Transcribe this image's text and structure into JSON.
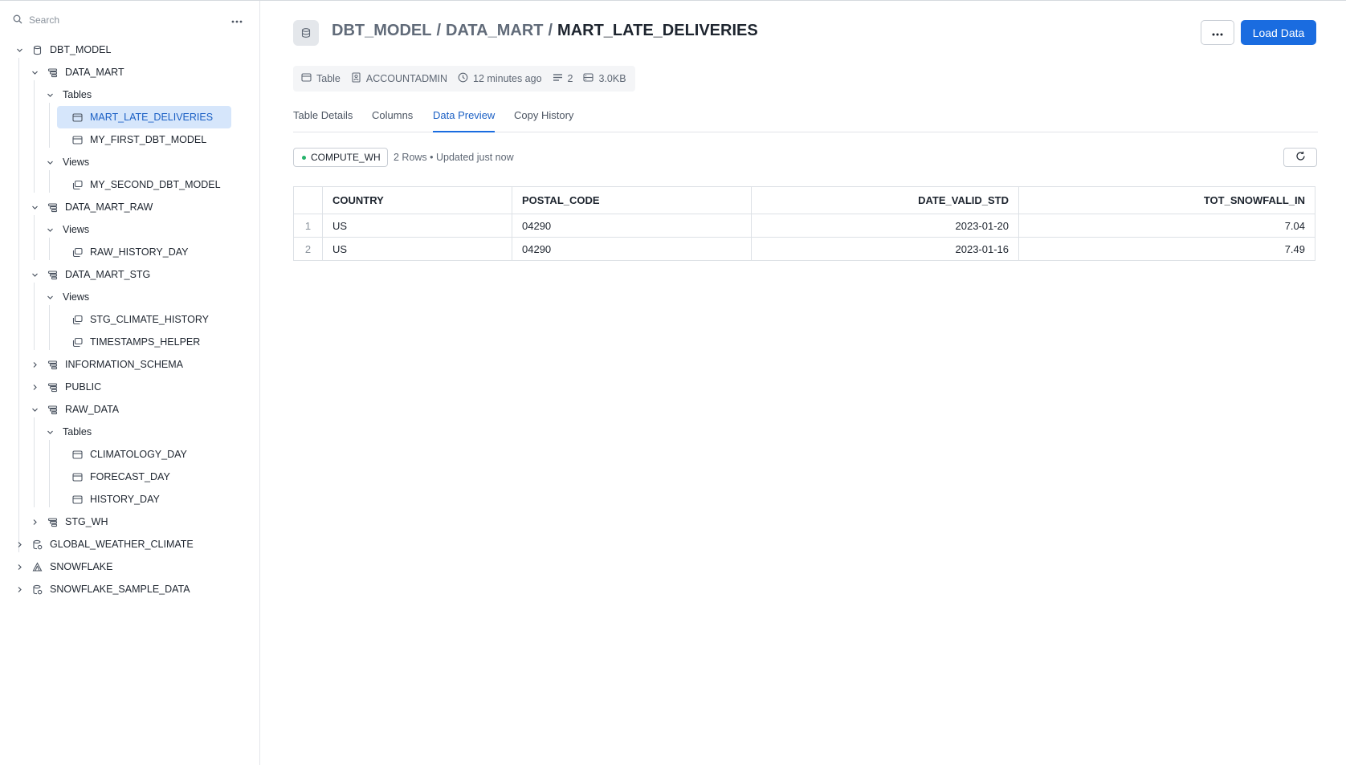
{
  "sidebar": {
    "search_placeholder": "Search",
    "more_icon": "ellipsis-icon",
    "tree": [
      {
        "label": "DBT_MODEL",
        "type": "database",
        "expanded": true
      },
      {
        "label": "DATA_MART",
        "type": "schema",
        "expanded": true
      },
      {
        "label": "Tables",
        "type": "folder",
        "expanded": true
      },
      {
        "label": "MART_LATE_DELIVERIES",
        "type": "table",
        "selected": true
      },
      {
        "label": "MY_FIRST_DBT_MODEL",
        "type": "table"
      },
      {
        "label": "Views",
        "type": "folder",
        "expanded": true
      },
      {
        "label": "MY_SECOND_DBT_MODEL",
        "type": "view"
      },
      {
        "label": "DATA_MART_RAW",
        "type": "schema",
        "expanded": true
      },
      {
        "label": "Views",
        "type": "folder",
        "expanded": true
      },
      {
        "label": "RAW_HISTORY_DAY",
        "type": "view"
      },
      {
        "label": "DATA_MART_STG",
        "type": "schema",
        "expanded": true
      },
      {
        "label": "Views",
        "type": "folder",
        "expanded": true
      },
      {
        "label": "STG_CLIMATE_HISTORY",
        "type": "view"
      },
      {
        "label": "TIMESTAMPS_HELPER",
        "type": "view"
      },
      {
        "label": "INFORMATION_SCHEMA",
        "type": "schema",
        "expanded": false
      },
      {
        "label": "PUBLIC",
        "type": "schema",
        "expanded": false
      },
      {
        "label": "RAW_DATA",
        "type": "schema",
        "expanded": true
      },
      {
        "label": "Tables",
        "type": "folder",
        "expanded": true
      },
      {
        "label": "CLIMATOLOGY_DAY",
        "type": "table"
      },
      {
        "label": "FORECAST_DAY",
        "type": "table"
      },
      {
        "label": "HISTORY_DAY",
        "type": "table"
      },
      {
        "label": "STG_WH",
        "type": "schema",
        "expanded": false
      },
      {
        "label": "GLOBAL_WEATHER_CLIMATE",
        "type": "shared-database",
        "expanded": false
      },
      {
        "label": "SNOWFLAKE",
        "type": "snowflake-database",
        "expanded": false
      },
      {
        "label": "SNOWFLAKE_SAMPLE_DATA",
        "type": "shared-database",
        "expanded": false
      }
    ]
  },
  "header": {
    "breadcrumb": [
      "DBT_MODEL",
      "DATA_MART"
    ],
    "separator": "/",
    "current": "MART_LATE_DELIVERIES",
    "load_button": "Load Data",
    "more_icon": "ellipsis-icon"
  },
  "meta": {
    "type": "Table",
    "owner": "ACCOUNTADMIN",
    "updated": "12 minutes ago",
    "rows": "2",
    "size": "3.0KB"
  },
  "tabs": [
    {
      "label": "Table Details",
      "active": false
    },
    {
      "label": "Columns",
      "active": false
    },
    {
      "label": "Data Preview",
      "active": true
    },
    {
      "label": "Copy History",
      "active": false
    }
  ],
  "preview": {
    "warehouse": "COMPUTE_WH",
    "status": "2 Rows • Updated just now",
    "columns": [
      "COUNTRY",
      "POSTAL_CODE",
      "DATE_VALID_STD",
      "TOT_SNOWFALL_IN"
    ],
    "rows": [
      {
        "n": "1",
        "cells": [
          "US",
          "04290",
          "2023-01-20",
          "7.04"
        ]
      },
      {
        "n": "2",
        "cells": [
          "US",
          "04290",
          "2023-01-16",
          "7.49"
        ]
      }
    ]
  },
  "colors": {
    "accent": "#1a6ce0",
    "selected_bg": "#d6e6fb",
    "warehouse_dot": "#26b36b"
  }
}
